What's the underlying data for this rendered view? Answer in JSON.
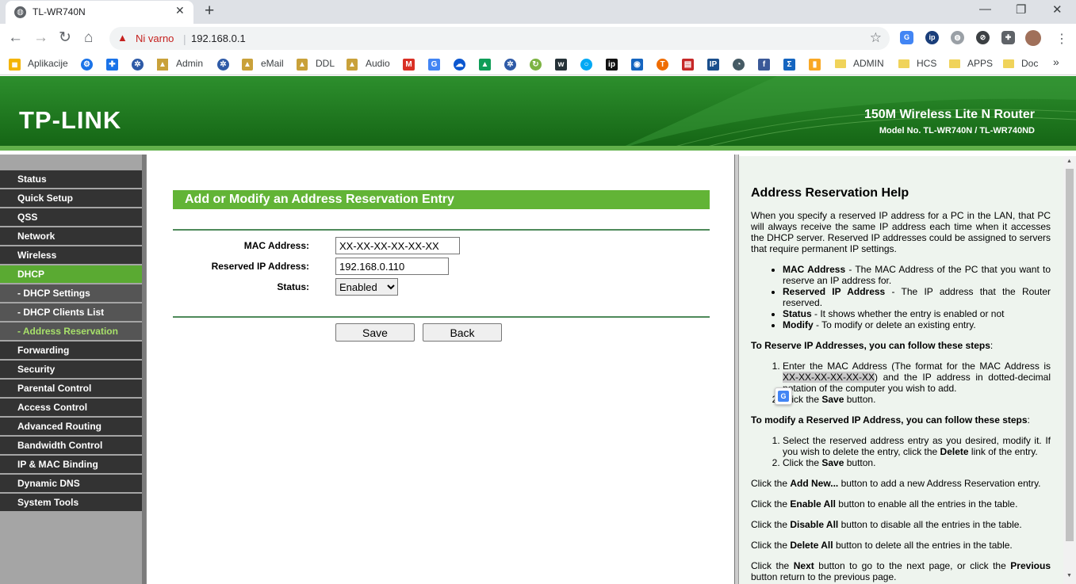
{
  "browser": {
    "tab_title": "TL-WR740N",
    "tab_close": "✕",
    "new_tab": "+",
    "win_min": "—",
    "win_max": "❐",
    "win_close": "✕",
    "back": "←",
    "forward": "→",
    "reload": "↻",
    "home": "⌂",
    "warning_icon": "▲",
    "security_label": "Ni varno",
    "separator": "|",
    "url": "192.168.0.1",
    "star": "☆",
    "menu": "⋮"
  },
  "bookmarks": {
    "apps_label": "Aplikacije",
    "admin": "Admin",
    "email": "eMail",
    "ddl": "DDL",
    "audio": "Audio",
    "admin_caps": "ADMIN",
    "hcs": "HCS",
    "apps": "APPS",
    "doc": "Doc",
    "more": "»"
  },
  "router": {
    "logo": "TP-LINK",
    "product_name": "150M Wireless Lite N Router",
    "model_no": "Model No. TL-WR740N / TL-WR740ND"
  },
  "menu": {
    "items": [
      {
        "label": "Status",
        "type": "top"
      },
      {
        "label": "Quick Setup",
        "type": "top"
      },
      {
        "label": "QSS",
        "type": "top"
      },
      {
        "label": "Network",
        "type": "top"
      },
      {
        "label": "Wireless",
        "type": "top"
      },
      {
        "label": "DHCP",
        "type": "active"
      },
      {
        "label": "- DHCP Settings",
        "type": "sub"
      },
      {
        "label": "- DHCP Clients List",
        "type": "sub"
      },
      {
        "label": "- Address Reservation",
        "type": "sub-selected"
      },
      {
        "label": "Forwarding",
        "type": "top"
      },
      {
        "label": "Security",
        "type": "top"
      },
      {
        "label": "Parental Control",
        "type": "top"
      },
      {
        "label": "Access Control",
        "type": "top"
      },
      {
        "label": "Advanced Routing",
        "type": "top"
      },
      {
        "label": "Bandwidth Control",
        "type": "top"
      },
      {
        "label": "IP & MAC Binding",
        "type": "top"
      },
      {
        "label": "Dynamic DNS",
        "type": "top"
      },
      {
        "label": "System Tools",
        "type": "top"
      }
    ]
  },
  "form": {
    "title": "Add or Modify an Address Reservation Entry",
    "mac_label": "MAC Address:",
    "mac_value": "XX-XX-XX-XX-XX-XX",
    "ip_label": "Reserved IP Address:",
    "ip_value": "192.168.0.110",
    "status_label": "Status:",
    "status_value": "Enabled",
    "save": "Save",
    "back": "Back"
  },
  "help": {
    "title": "Address Reservation Help",
    "intro": "When you specify a reserved IP address for a PC in the LAN, that PC will always receive the same IP address each time when it accesses the DHCP server. Reserved IP addresses could be assigned to servers that require permanent IP settings.",
    "mac_term": "MAC Address",
    "mac_desc": " - The MAC Address of the PC that you want to reserve an IP address for.",
    "ip_term": "Reserved IP Address",
    "ip_desc": " - The IP address that the Router reserved.",
    "status_term": "Status",
    "status_desc": " - It shows whether the entry is enabled or not",
    "modify_term": "Modify",
    "modify_desc": " - To modify or delete an existing entry.",
    "reserve_heading": "To Reserve IP Addresses, you can follow these steps",
    "reserve_step1_a": "Enter the MAC Address (The format for the MAC Address is ",
    "reserve_step1_mac": "XX-XX-XX-XX-XX-XX",
    "reserve_step1_b": ") and the IP address in dotted-decimal notation of the computer you wish to add.",
    "reserve_step2_a": "Click the ",
    "save_word": "Save",
    "button_word": " button.",
    "modify_heading": "To modify a Reserved IP Address, you can follow these steps",
    "modify_step1_a": "Select the reserved address entry as you desired, modify it. If you wish to delete the entry, click the ",
    "delete_word": "Delete",
    "modify_step1_b": " link of the entry.",
    "click_the": "Click the ",
    "add_new": "Add New...",
    "add_new_desc": " button to add a new Address Reservation entry.",
    "enable_all": "Enable All",
    "enable_all_desc": " button to enable all the entries in the table.",
    "disable_all": "Disable All",
    "disable_all_desc": " button to disable all the entries in the table.",
    "delete_all": "Delete All",
    "delete_all_desc": " button to delete all the entries in the table.",
    "next": "Next",
    "next_desc": " button to go to the next page, or click the ",
    "previous": "Previous",
    "previous_desc": " button return to the previous page."
  },
  "colors": {
    "banner_green": "#146414",
    "accent_green": "#62b436",
    "menu_dark": "#333333",
    "help_bg": "#eef4ee"
  }
}
